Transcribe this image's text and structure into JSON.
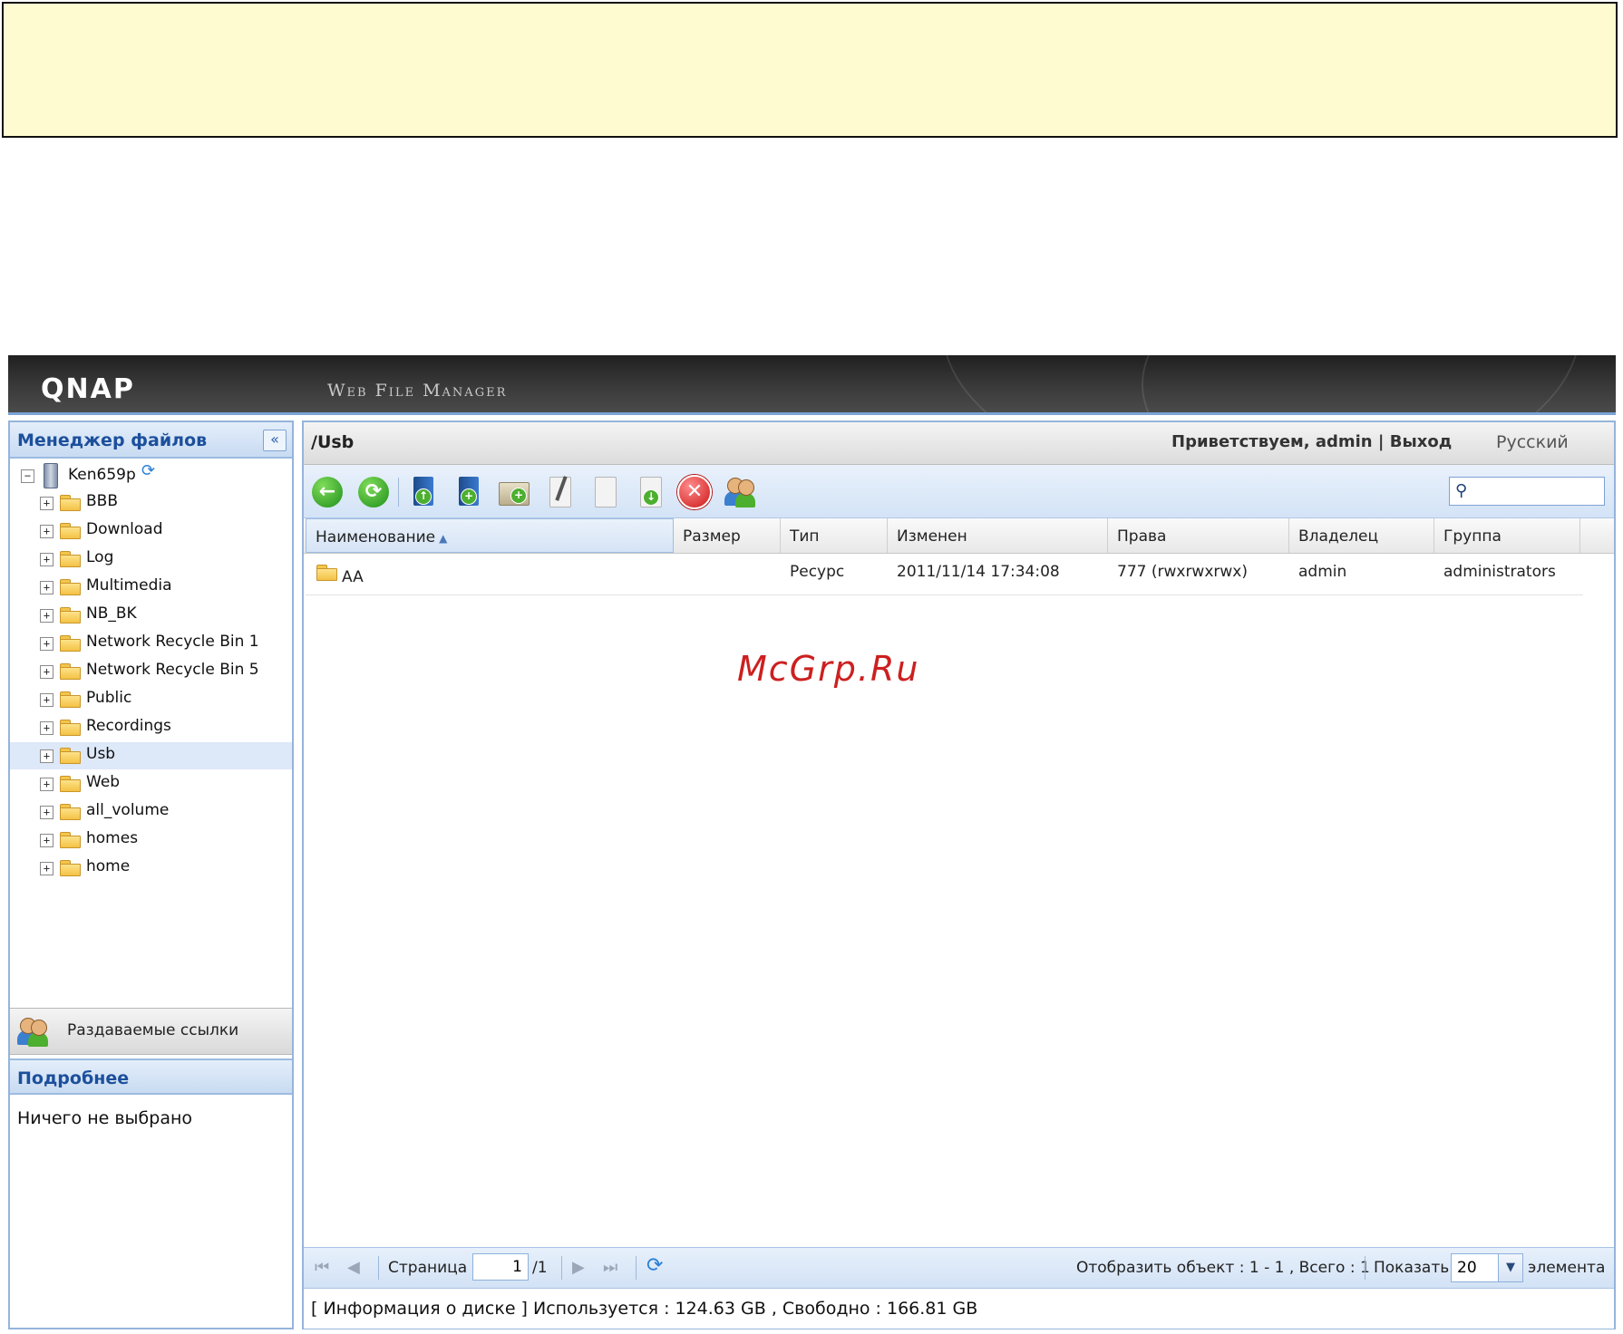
{
  "header": {
    "logo": "QNAP",
    "product": "Web File Manager"
  },
  "sidebar": {
    "title": "Менеджер файлов",
    "collapse_icon": "«",
    "root": "Ken659p",
    "folders": [
      "BBB",
      "Download",
      "Log",
      "Multimedia",
      "NB_BK",
      "Network Recycle Bin 1",
      "Network Recycle Bin 5",
      "Public",
      "Recordings",
      "Usb",
      "Web",
      "all_volume",
      "homes",
      "home"
    ],
    "selected": "Usb",
    "share_links": "Раздаваемые ссылки",
    "details_title": "Подробнее",
    "details_text": "Ничего не выбрано"
  },
  "main": {
    "path": "/Usb",
    "welcome": "Приветствуем, admin",
    "separator": "|",
    "logout": "Выход",
    "language": "Русский",
    "search_placeholder": ""
  },
  "toolbar": [
    "back-icon",
    "refresh-icon",
    "upload-icon",
    "create-share-icon",
    "new-folder-icon",
    "rename-icon",
    "copy-icon",
    "move-icon",
    "delete-icon",
    "share-link-icon"
  ],
  "grid": {
    "columns": [
      "Наименование",
      "Размер",
      "Тип",
      "Изменен",
      "Права",
      "Владелец",
      "Группа"
    ],
    "rows": [
      {
        "name": "AA",
        "size": "",
        "type": "Ресурс",
        "modified": "2011/11/14 17:34:08",
        "permissions": "777 (rwxrwxrwx)",
        "owner": "admin",
        "group": "administrators"
      }
    ]
  },
  "watermark": "McGrp.Ru",
  "pager": {
    "page_label": "Страница",
    "page_value": "1",
    "page_total": "/1",
    "display_info": "Отобразить объект : 1 - 1 , Всего : 1",
    "show_label": "Показать",
    "per_page": "20",
    "items_label": "элемента"
  },
  "status": "[ Информация о диске ] Используется : 124.63 GB , Свободно : 166.81 GB",
  "colors": {
    "accent": "#1c4f9c",
    "panel": "#d3e3f6",
    "watermark": "#cc2020"
  }
}
